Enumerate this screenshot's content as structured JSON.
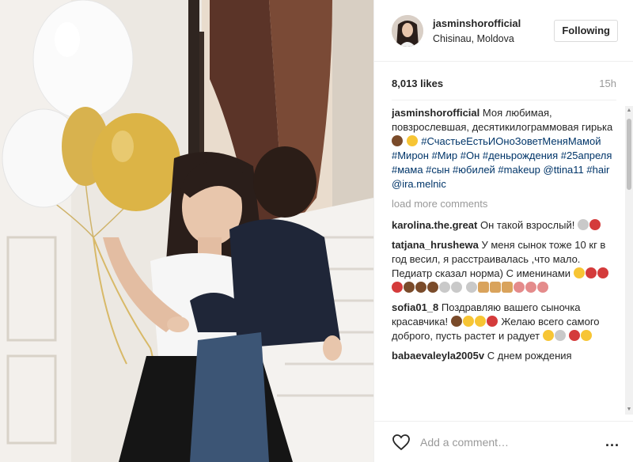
{
  "post": {
    "username": "jasminshorofficial",
    "location": "Chisinau, Moldova",
    "follow_label": "Following",
    "likes": "8,013 likes",
    "time": "15h"
  },
  "caption": {
    "username": "jasminshorofficial",
    "text": "Моя любимая, повзрослевшая, десятикилограммовая гирька",
    "hashtags": "#СчастьеЕстьИОноЗоветМеняМамой #Мирон #Мир #Он #деньрождения #25апреля #мама #сын #юбилей #makeup @ttina11 #hair @ira.melnic"
  },
  "load_more": "load more comments",
  "comments": [
    {
      "user": "karolina.the.great",
      "text": "Он такой взрослый!"
    },
    {
      "user": "tatjana_hrushewa",
      "text": "У меня сынок тоже 10 кг в год весил, я расстраивалась ,что мало. Педиатр сказал норма) С именинами"
    },
    {
      "user": "sofia01_8",
      "text": "Поздравляю вашего сыночка красавчика!",
      "text2": "Желаю всего самого доброго, пусть растет и радует"
    },
    {
      "user": "babaevaleyla2005v",
      "text": "С днем рождения"
    }
  ],
  "footer": {
    "placeholder": "Add a comment…",
    "more": "..."
  },
  "icons": {
    "heart": "heart-icon",
    "more": "more-options-icon"
  }
}
